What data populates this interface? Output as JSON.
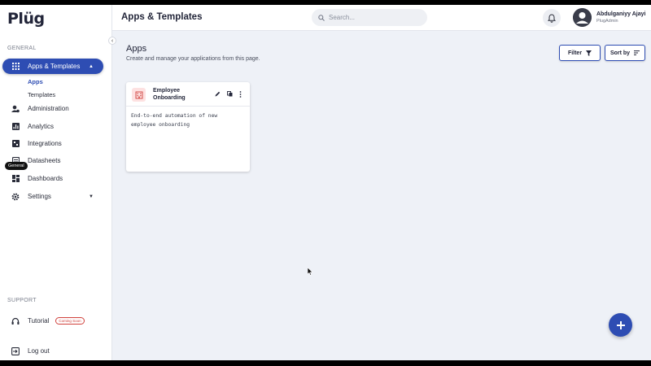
{
  "brand": {
    "logo_text": "Plüg"
  },
  "sidebar": {
    "general_label": "GENERAL",
    "items": [
      {
        "label": "Apps & Templates",
        "icon": "grid-icon",
        "active": true
      },
      {
        "label": "Administration",
        "icon": "admin-icon"
      },
      {
        "label": "Analytics",
        "icon": "analytics-icon"
      },
      {
        "label": "Integrations",
        "icon": "integrations-icon"
      },
      {
        "label": "Datasheets",
        "icon": "datasheets-icon"
      },
      {
        "label": "Dashboards",
        "icon": "dashboards-icon"
      },
      {
        "label": "Settings",
        "icon": "gear-icon"
      }
    ],
    "sub_items": [
      {
        "label": "Apps",
        "selected": true
      },
      {
        "label": "Templates"
      }
    ],
    "support_label": "SUPPORT",
    "tutorial": {
      "label": "Tutorial",
      "badge": "Coming Soon"
    },
    "logout": {
      "label": "Log out"
    }
  },
  "header": {
    "title": "Apps & Templates",
    "search_placeholder": "Search...",
    "user": {
      "name": "Abdulganiyy Ajayi",
      "role": "PlugAdmin"
    }
  },
  "main": {
    "title": "Apps",
    "subtitle": "Create and manage your applications from this page.",
    "filter_label": "Filter",
    "sort_label": "Sort by",
    "cards": [
      {
        "name": "Employee Onboarding",
        "description": "End-to-end automation of new employee onboarding",
        "tag": "General"
      }
    ]
  },
  "colors": {
    "accent": "#2e4db3",
    "badge": "#d0413c",
    "icon_bg": "#fde1e1"
  }
}
